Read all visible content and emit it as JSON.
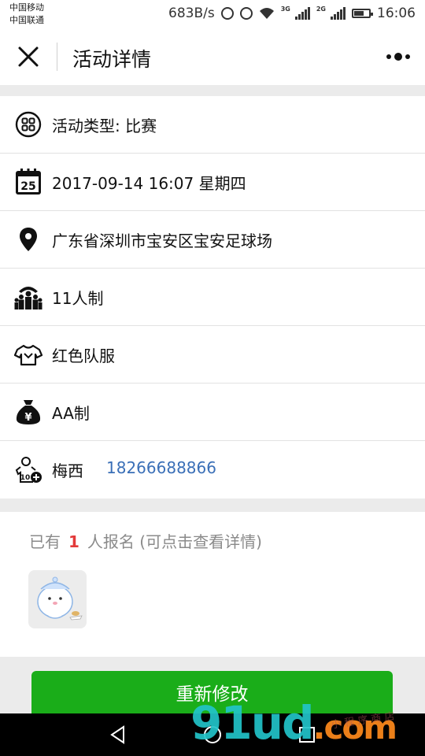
{
  "status_bar": {
    "carrier_1": "中国移动",
    "carrier_2": "中国联通",
    "speed": "683B/s",
    "network_1": "3G",
    "network_2": "2G",
    "time": "16:06"
  },
  "header": {
    "title": "活动详情",
    "close_icon": "close-icon",
    "more_icon": "more-icon"
  },
  "info": {
    "type": "活动类型: 比赛",
    "datetime": "2017-09-14 16:07 星期四",
    "location": "广东省深圳市宝安区宝安足球场",
    "format": "11人制",
    "uniform": "红色队服",
    "fee": "AA制",
    "contact_name": "梅西",
    "contact_phone": "18266688866",
    "calendar_day": "25",
    "jersey_number": "10"
  },
  "signup": {
    "prefix": "已有",
    "count": "1",
    "suffix": "人报名 (可点击查看详情)"
  },
  "actions": {
    "modify_label": "重新修改"
  },
  "watermark": {
    "brand": "91ud",
    "suffix": ".com",
    "small": "小 程 序 商 店"
  },
  "colors": {
    "accent_green": "#1aad19",
    "count_red": "#e33a3a",
    "phone_blue": "#3a6fb7"
  }
}
